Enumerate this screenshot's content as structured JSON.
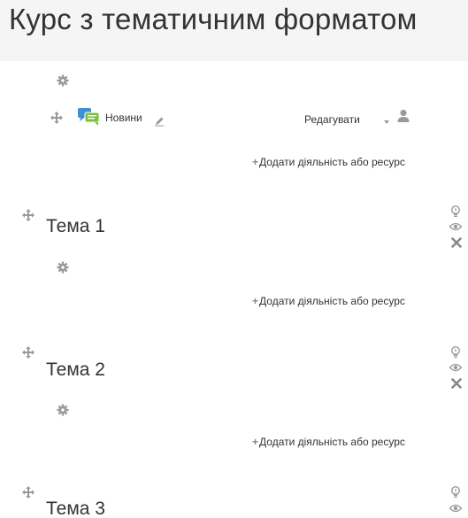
{
  "course": {
    "title": "Курс з тематичним форматом"
  },
  "general_section": {
    "activity": {
      "name": "Новини",
      "edit_menu_label": "Редагувати"
    },
    "add_activity_label": "Додати діяльність або ресурс"
  },
  "sections": [
    {
      "title": "Тема 1",
      "add_activity_label": "Додати діяльність або ресурс"
    },
    {
      "title": "Тема 2",
      "add_activity_label": "Додати діяльність або ресурс"
    },
    {
      "title": "Тема 3"
    }
  ],
  "colors": {
    "header_bg": "#f5f5f5",
    "icon_gray": "#999999",
    "forum_icon_blue": "#3d8fd6",
    "forum_icon_green": "#7ac143"
  },
  "icons": {
    "gear": "gear-icon",
    "move": "move-icon",
    "highlight": "lightbulb-icon",
    "visibility": "eye-icon",
    "delete": "delete-icon",
    "forum": "forum-icon",
    "pencil": "pencil-icon",
    "dropdown": "caret-down-icon",
    "user": "user-icon",
    "add": "plus-icon"
  }
}
